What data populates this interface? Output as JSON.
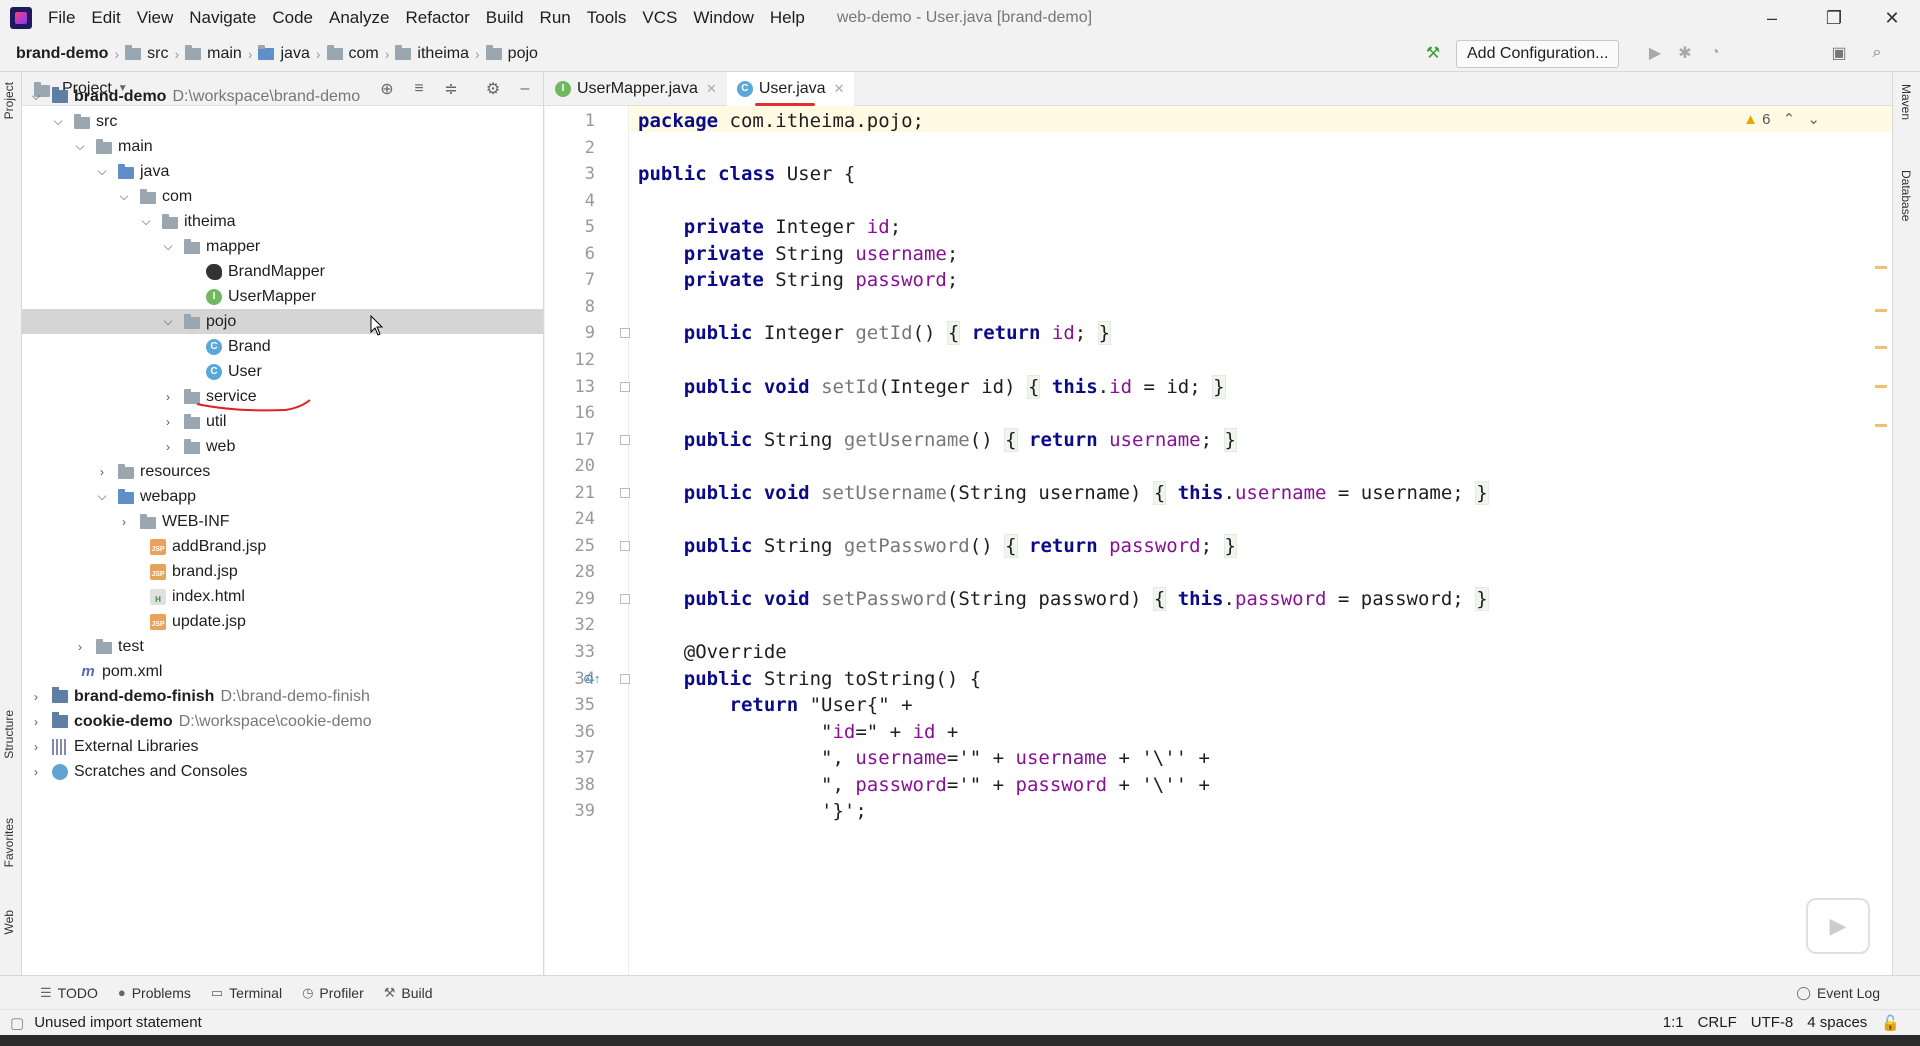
{
  "menubar": {
    "items": [
      "File",
      "Edit",
      "View",
      "Navigate",
      "Code",
      "Analyze",
      "Refactor",
      "Build",
      "Run",
      "Tools",
      "VCS",
      "Window",
      "Help"
    ],
    "window_title": "web-demo - User.java [brand-demo]"
  },
  "navbar": {
    "crumbs": [
      "brand-demo",
      "src",
      "main",
      "java",
      "com",
      "itheima",
      "pojo"
    ],
    "add_configuration": "Add Configuration..."
  },
  "side_tabs": {
    "left": [
      "Project",
      "Structure",
      "Favorites",
      "Web"
    ],
    "right": [
      "Maven",
      "Database"
    ]
  },
  "project": {
    "title": "Project",
    "tree": [
      {
        "label": "brand-demo",
        "path": "D:\\workspace\\brand-demo"
      },
      {
        "label": "src"
      },
      {
        "label": "main"
      },
      {
        "label": "java"
      },
      {
        "label": "com"
      },
      {
        "label": "itheima"
      },
      {
        "label": "mapper"
      },
      {
        "label": "BrandMapper"
      },
      {
        "label": "UserMapper"
      },
      {
        "label": "pojo"
      },
      {
        "label": "Brand"
      },
      {
        "label": "User"
      },
      {
        "label": "service"
      },
      {
        "label": "util"
      },
      {
        "label": "web"
      },
      {
        "label": "resources"
      },
      {
        "label": "webapp"
      },
      {
        "label": "WEB-INF"
      },
      {
        "label": "addBrand.jsp"
      },
      {
        "label": "brand.jsp"
      },
      {
        "label": "index.html"
      },
      {
        "label": "update.jsp"
      },
      {
        "label": "test"
      },
      {
        "label": "pom.xml"
      },
      {
        "label": "brand-demo-finish",
        "path": "D:\\brand-demo-finish"
      },
      {
        "label": "cookie-demo",
        "path": "D:\\workspace\\cookie-demo"
      },
      {
        "label": "External Libraries"
      },
      {
        "label": "Scratches and Consoles"
      }
    ]
  },
  "tabs": [
    {
      "label": "UserMapper.java",
      "icon": "interface-icon"
    },
    {
      "label": "User.java",
      "icon": "class-icon"
    }
  ],
  "editor": {
    "warnings": "6",
    "line_numbers": [
      "1",
      "2",
      "3",
      "4",
      "5",
      "6",
      "7",
      "8",
      "9",
      "12",
      "13",
      "16",
      "17",
      "20",
      "21",
      "24",
      "25",
      "28",
      "29",
      "32",
      "33",
      "34",
      "35",
      "36",
      "37",
      "38",
      "39"
    ],
    "code": [
      "package com.itheima.pojo;",
      "",
      "public class User {",
      "",
      "    private Integer id;",
      "    private String username;",
      "    private String password;",
      "",
      "    public Integer getId() { return id; }",
      "",
      "    public void setId(Integer id) { this.id = id; }",
      "",
      "    public String getUsername() { return username; }",
      "",
      "    public void setUsername(String username) { this.username = username; }",
      "",
      "    public String getPassword() { return password; }",
      "",
      "    public void setPassword(String password) { this.password = password; }",
      "",
      "    @Override",
      "    public String toString() {",
      "        return \"User{\" +",
      "                \"id=\" + id +",
      "                \", username='\" + username + '\\'' +",
      "                \", password='\" + password + '\\'' +",
      "                '}';"
    ]
  },
  "toolwindows": [
    "TODO",
    "Problems",
    "Terminal",
    "Profiler",
    "Build"
  ],
  "event_log": "Event Log",
  "status": {
    "message": "Unused import statement",
    "position": "1:1",
    "line_sep": "CRLF",
    "encoding": "UTF-8",
    "indent": "4 spaces"
  },
  "colors": {
    "keyword": "#0b0b8a",
    "field": "#871094",
    "string": "#067d17",
    "annotation": "#9e880d",
    "selection": "#d5d5d5"
  }
}
